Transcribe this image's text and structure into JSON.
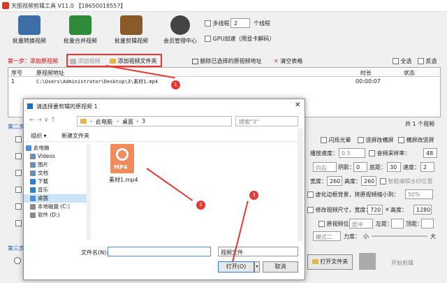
{
  "window": {
    "title": "天图视频剪辑工具 V11.0 【18650018557】"
  },
  "toolbar": {
    "tools": [
      {
        "label": "批量转换视频",
        "color": "#3d6ea8"
      },
      {
        "label": "批量合并视频",
        "color": "#2e8b3b"
      },
      {
        "label": "批量剪辑视频",
        "color": "#8a5a2a"
      },
      {
        "label": "会员管理中心",
        "color": "#444"
      }
    ],
    "multithread_label": "多线程",
    "thread_count": "2",
    "thread_unit": "个线程",
    "gpu_label": "GPU加速（用显卡解码）"
  },
  "step1": {
    "title": "第一步：添加原视频",
    "add_video": "添加视频",
    "add_folder": "添加视频文件夹",
    "delete_selected": "删除已选择的原视频地址",
    "clear_table": "清空表格",
    "select_all": "全选",
    "invert": "反选"
  },
  "table": {
    "col_index": "序号",
    "col_path": "原视频地址",
    "col_duration": "时长",
    "col_status": "状态",
    "rows": [
      {
        "index": "1",
        "path": "C:\\Users\\Administrator\\Desktop\\3\\素材1.mp4",
        "duration": "00:00:07",
        "status": ""
      }
    ],
    "total": "共 1 个视频"
  },
  "step2": {
    "title": "第二步"
  },
  "step3": {
    "title": "第三步"
  },
  "right_opts": {
    "flash": "闪烁光晕",
    "v_mirror": "竖屏改横屏",
    "h_mirror": "横屏改竖屏",
    "speed_label": "播放速度：",
    "speed_val": "0.5",
    "sample_label": "音频采样率：",
    "sample_val": "48",
    "dir_val": "向右",
    "shadow_label": "阴影：",
    "shadow_val": "0",
    "bottom_label": "底距：",
    "bottom_val": "30",
    "spd_label": "速度：",
    "spd_val": "2",
    "width_label": "宽度：",
    "width_val": "260",
    "height_label": "高度：",
    "height_val": "260",
    "smart_wm": "智能编辑水印位置",
    "blur_label": "虚化边框背景，将原视频缩小到：",
    "blur_val": "50%",
    "resize_label": "修改视频尺寸，宽度：",
    "resize_w": "720",
    "x": "×",
    "resize_h_label": "高度：",
    "resize_h": "1280",
    "pos_label": "原视频位置：",
    "pos_val": "居中",
    "left_label": "左距：",
    "top_label": "顶距：",
    "template_val": "模式二",
    "force_label": "力度：",
    "small": "小",
    "big": "大",
    "open_folder": "打开文件夹",
    "start_clip": "开始剪辑"
  },
  "dialog": {
    "title": "请选择要剪辑的原视频 1",
    "crumbs": [
      "此电脑",
      "桌面",
      "3"
    ],
    "search_placeholder": "搜索\"3\"",
    "organize": "组织",
    "new_folder": "新建文件夹",
    "nav": [
      {
        "label": "此电脑",
        "color": "#4a90d9"
      },
      {
        "label": "Videos",
        "color": "#6b8fb3"
      },
      {
        "label": "图片",
        "color": "#6b8fb3"
      },
      {
        "label": "文档",
        "color": "#6b8fb3"
      },
      {
        "label": "下载",
        "color": "#2f7fd1"
      },
      {
        "label": "音乐",
        "color": "#2f7fd1"
      },
      {
        "label": "桌面",
        "color": "#4a90d9"
      },
      {
        "label": "本地磁盘 (C:)",
        "color": "#8a8a8a"
      },
      {
        "label": "软件 (D:)",
        "color": "#8a8a8a"
      }
    ],
    "file": {
      "name": "素材1.mp4",
      "ext": "MP4"
    },
    "filename_label": "文件名(N):",
    "filetype_val": "视频文件",
    "open": "打开(O)",
    "cancel": "取消"
  },
  "annotations": [
    "1",
    "2",
    "3"
  ]
}
